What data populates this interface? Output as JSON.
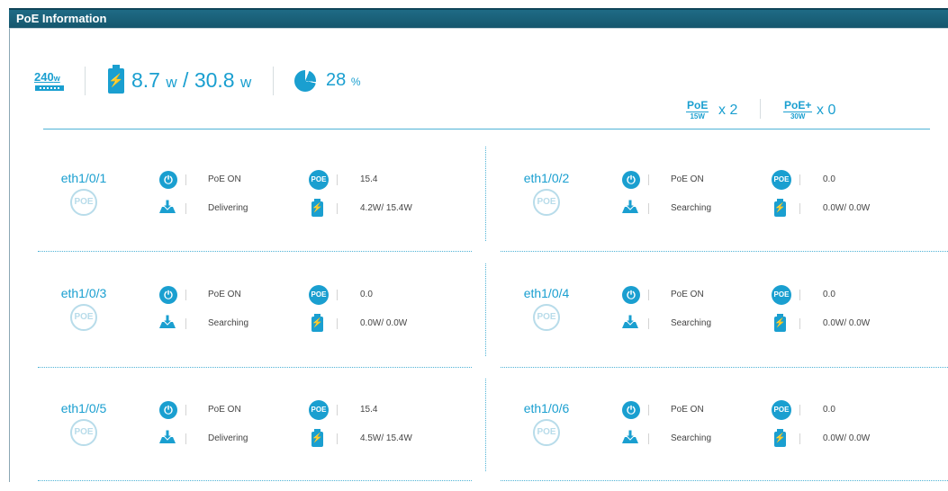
{
  "title": "PoE Information",
  "summary": {
    "budget_value": "240",
    "budget_unit": "w",
    "used_value": "8.7",
    "used_unit": "w",
    "separator": "/",
    "total_value": "30.8",
    "total_unit": "w",
    "percent_value": "28",
    "percent_unit": "%"
  },
  "classes": [
    {
      "top": "PoE",
      "bottom": "15W",
      "count_label": "x 2"
    },
    {
      "top": "PoE+",
      "bottom": "30W",
      "count_label": "x 0"
    }
  ],
  "ports": [
    {
      "name": "eth1/0/1",
      "badge": "POE",
      "admin": "PoE ON",
      "power": "15.4",
      "status": "Delivering",
      "usage": "4.2W/ 15.4W",
      "poe_icon": "POE"
    },
    {
      "name": "eth1/0/2",
      "badge": "POE",
      "admin": "PoE ON",
      "power": "0.0",
      "status": "Searching",
      "usage": "0.0W/ 0.0W",
      "poe_icon": "POE"
    },
    {
      "name": "eth1/0/3",
      "badge": "POE",
      "admin": "PoE ON",
      "power": "0.0",
      "status": "Searching",
      "usage": "0.0W/ 0.0W",
      "poe_icon": "POE"
    },
    {
      "name": "eth1/0/4",
      "badge": "POE",
      "admin": "PoE ON",
      "power": "0.0",
      "status": "Searching",
      "usage": "0.0W/ 0.0W",
      "poe_icon": "POE"
    },
    {
      "name": "eth1/0/5",
      "badge": "POE",
      "admin": "PoE ON",
      "power": "15.4",
      "status": "Delivering",
      "usage": "4.5W/ 15.4W",
      "poe_icon": "POE"
    },
    {
      "name": "eth1/0/6",
      "badge": "POE",
      "admin": "PoE ON",
      "power": "0.0",
      "status": "Searching",
      "usage": "0.0W/ 0.0W",
      "poe_icon": "POE"
    }
  ],
  "colors": {
    "accent": "#1a9fd0",
    "header": "#1c6680"
  },
  "icons": {
    "power": "power-icon",
    "download": "download-icon",
    "battery": "battery-icon",
    "pie": "pie-chart-icon"
  }
}
